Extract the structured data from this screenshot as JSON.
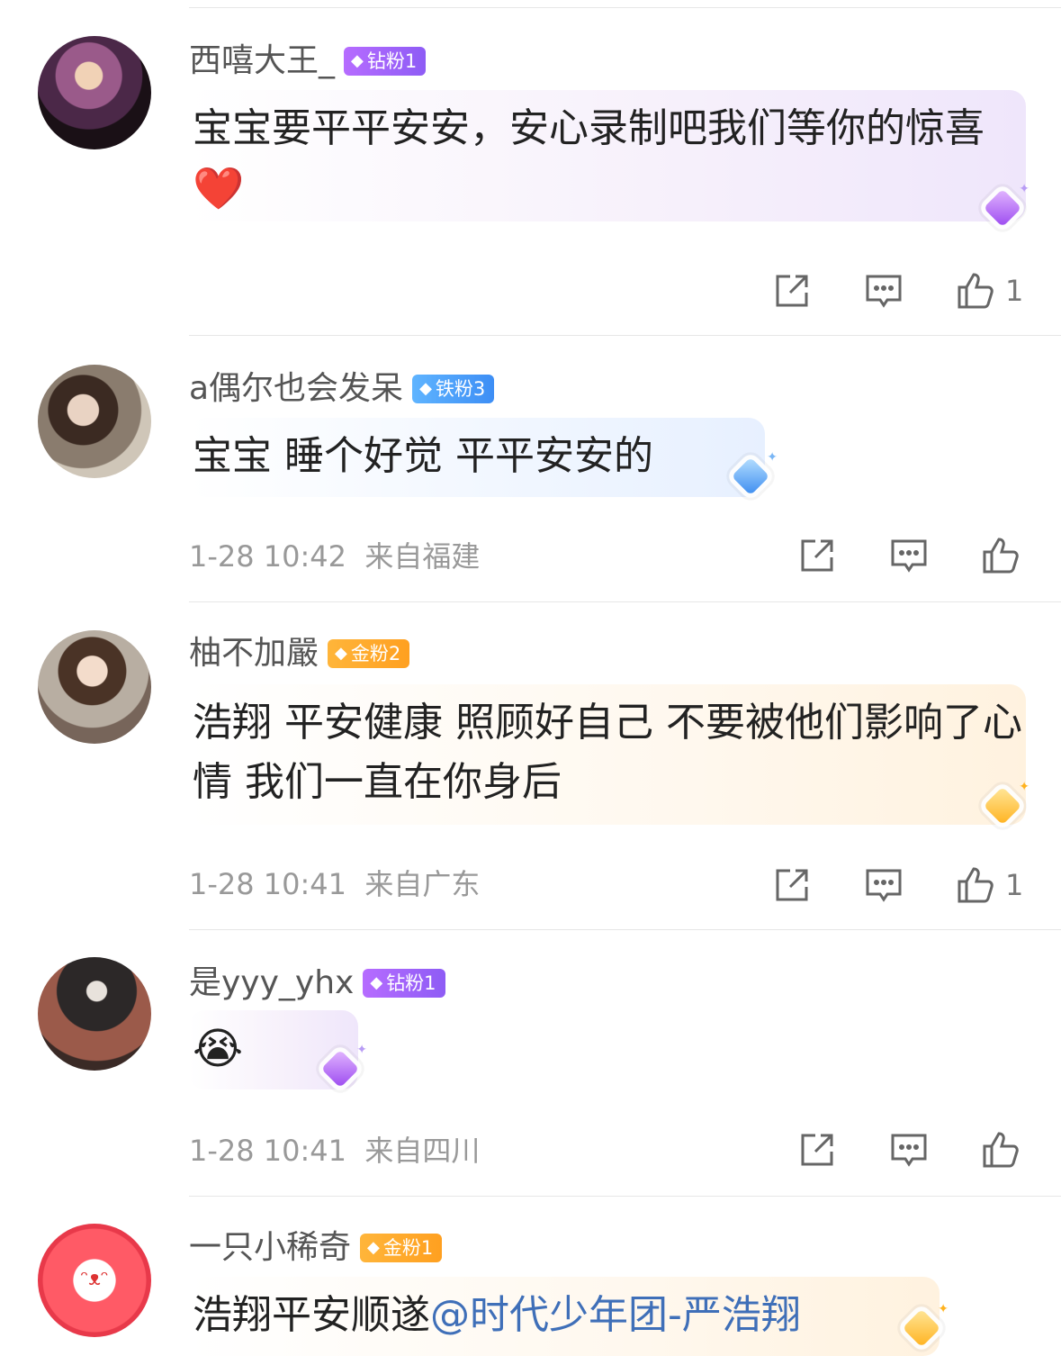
{
  "comments": [
    {
      "username": "西嘻大王_",
      "badge": {
        "label": "钻粉1",
        "color": "#9b5cf6"
      },
      "text": "宝宝要平平安安，安心录制吧我们等你的惊喜",
      "emoji": "❤️",
      "time": "",
      "location": "",
      "like_count": "1"
    },
    {
      "username": "a偶尔也会发呆",
      "badge": {
        "label": "铁粉3",
        "color": "#3d8ef5"
      },
      "text": "宝宝 睡个好觉 平平安安的",
      "time": "1-28 10:42",
      "location": "来自福建",
      "like_count": ""
    },
    {
      "username": "柚不加嚴",
      "badge": {
        "label": "金粉2",
        "color": "#ffa020"
      },
      "text": "浩翔 平安健康 照顾好自己 不要被他们影响了心情 我们一直在你身后",
      "time": "1-28 10:41",
      "location": "来自广东",
      "like_count": "1"
    },
    {
      "username": "是yyy_yhx",
      "badge": {
        "label": "钻粉1",
        "color": "#9b5cf6"
      },
      "emoji": "😭",
      "time": "1-28 10:41",
      "location": "来自四川",
      "like_count": ""
    },
    {
      "username": "一只小稀奇",
      "badge": {
        "label": "金粉1",
        "color": "#ffa020"
      },
      "text": "浩翔平安顺遂",
      "mention": "@时代少年团-严浩翔"
    }
  ],
  "icons": [
    "share-icon",
    "comment-icon",
    "like-icon"
  ]
}
